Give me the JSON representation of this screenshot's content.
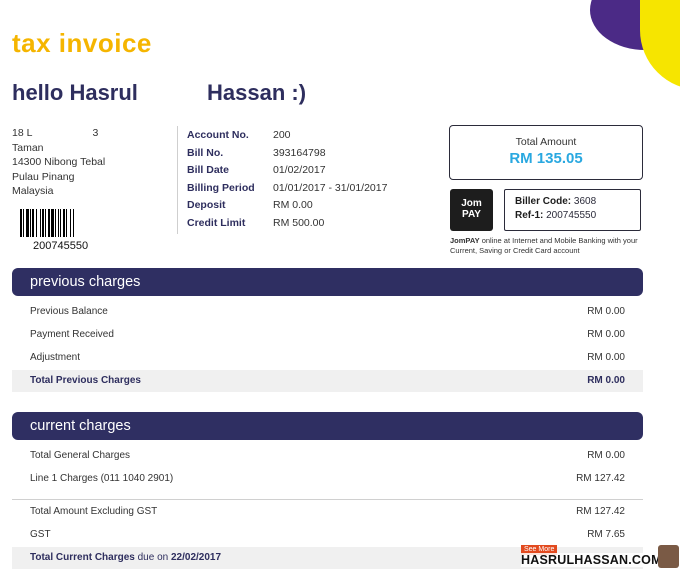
{
  "invoice": {
    "title": "tax invoice",
    "greeting_first": "hello Hasrul",
    "greeting_last": "Hassan :)"
  },
  "address": {
    "lines": [
      "18 L",
      "Taman",
      "14300 Nibong Tebal",
      "Pulau Pinang",
      "Malaysia"
    ],
    "line1_suffix": "3"
  },
  "barcode": {
    "number": "200745550"
  },
  "account_info": [
    {
      "label": "Account No.",
      "value": "200"
    },
    {
      "label": "Bill No.",
      "value": "393164798"
    },
    {
      "label": "Bill Date",
      "value": "01/02/2017"
    },
    {
      "label": "Billing Period",
      "value": "01/01/2017 - 31/01/2017"
    },
    {
      "label": "Deposit",
      "value": "RM 0.00"
    },
    {
      "label": "Credit Limit",
      "value": "RM 500.00"
    }
  ],
  "total": {
    "label": "Total Amount",
    "amount": "RM 135.05"
  },
  "jompay": {
    "logo_line1": "Jom",
    "logo_line2": "PAY",
    "biller_code_label": "Biller Code:",
    "biller_code": "3608",
    "ref_label": "Ref-1:",
    "ref": "200745550",
    "note_bold": "JomPAY",
    "note": "online at Internet and Mobile Banking with your Current, Saving or Credit Card account"
  },
  "previous_charges": {
    "title": "previous charges",
    "rows": [
      {
        "label": "Previous Balance",
        "value": "RM 0.00"
      },
      {
        "label": "Payment Received",
        "value": "RM 0.00"
      },
      {
        "label": "Adjustment",
        "value": "RM 0.00"
      }
    ],
    "total_label": "Total Previous Charges",
    "total_value": "RM 0.00"
  },
  "current_charges": {
    "title": "current charges",
    "rows": [
      {
        "label": "Total General Charges",
        "value": "RM 0.00"
      },
      {
        "label": "Line 1 Charges (011 1040 2901)",
        "value": "RM 127.42"
      }
    ],
    "subtotal_rows": [
      {
        "label": "Total Amount Excluding GST",
        "value": "RM 127.42"
      },
      {
        "label": "GST",
        "value": "RM 7.65"
      }
    ],
    "total_label": "Total Current Charges",
    "total_due_word": "due on",
    "total_due_date": "22/02/2017"
  },
  "watermark": {
    "see_more": "See More",
    "site": "HASRULHASSAN.COM"
  },
  "colors": {
    "brand_yellow": "#f5b500",
    "brand_purple": "#2f2f62",
    "total_blue": "#29a8e0"
  }
}
